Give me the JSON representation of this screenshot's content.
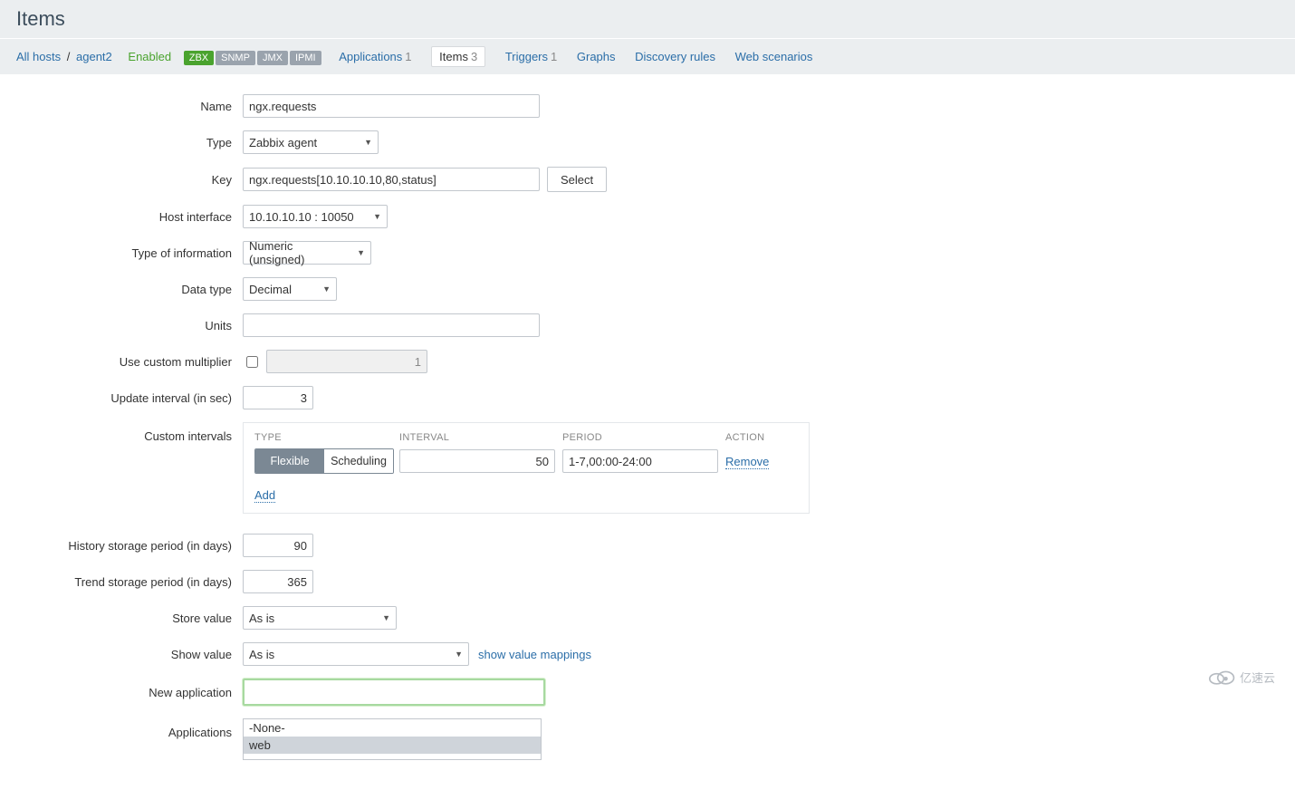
{
  "page": {
    "title": "Items"
  },
  "breadcrumb": {
    "all_hosts": "All hosts",
    "host": "agent2",
    "sep": "/"
  },
  "status": {
    "enabled": "Enabled"
  },
  "protoBadges": {
    "zbx": "ZBX",
    "snmp": "SNMP",
    "jmx": "JMX",
    "ipmi": "IPMI"
  },
  "nav": {
    "applications": {
      "label": "Applications",
      "count": "1"
    },
    "items": {
      "label": "Items",
      "count": "3"
    },
    "triggers": {
      "label": "Triggers",
      "count": "1"
    },
    "graphs": {
      "label": "Graphs"
    },
    "discovery": {
      "label": "Discovery rules"
    },
    "web": {
      "label": "Web scenarios"
    }
  },
  "labels": {
    "name": "Name",
    "type": "Type",
    "key": "Key",
    "host_interface": "Host interface",
    "type_of_information": "Type of information",
    "data_type": "Data type",
    "units": "Units",
    "use_custom_multiplier": "Use custom multiplier",
    "update_interval": "Update interval (in sec)",
    "custom_intervals": "Custom intervals",
    "history_storage": "History storage period (in days)",
    "trend_storage": "Trend storage period (in days)",
    "store_value": "Store value",
    "show_value": "Show value",
    "new_application": "New application",
    "applications": "Applications"
  },
  "form": {
    "name": "ngx.requests",
    "type": "Zabbix agent",
    "key": "ngx.requests[10.10.10.10,80,status]",
    "key_select_btn": "Select",
    "host_interface": "10.10.10.10 : 10050",
    "type_of_information": "Numeric (unsigned)",
    "data_type": "Decimal",
    "units": "",
    "use_custom_multiplier_checked": false,
    "custom_multiplier": "1",
    "update_interval": "3",
    "history_storage": "90",
    "trend_storage": "365",
    "store_value": "As is",
    "show_value": "As is",
    "show_value_mappings_link": "show value mappings",
    "new_application": ""
  },
  "customIntervals": {
    "columns": {
      "type": "TYPE",
      "interval": "INTERVAL",
      "period": "PERIOD",
      "action": "ACTION"
    },
    "row": {
      "type_flexible": "Flexible",
      "type_scheduling": "Scheduling",
      "interval": "50",
      "period": "1-7,00:00-24:00",
      "remove": "Remove"
    },
    "add": "Add"
  },
  "applications": {
    "options": [
      "-None-",
      "web"
    ],
    "selected": "web"
  },
  "watermark": {
    "text": "亿速云"
  }
}
